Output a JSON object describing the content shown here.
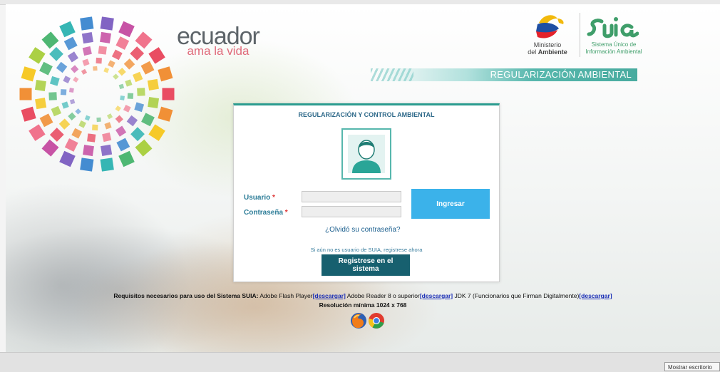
{
  "brand": {
    "title": "ecuador",
    "subtitle": "ama la vida"
  },
  "ministry": {
    "line1": "Ministerio",
    "line2_prefix": "del ",
    "line2_bold": "Ambiente"
  },
  "suia": {
    "line1": "Sistema Único de",
    "line2": "Información Ambiental"
  },
  "banner": {
    "text": "REGULARIZACIÓN AMBIENTAL"
  },
  "login": {
    "title": "REGULARIZACIÓN Y CONTROL AMBIENTAL",
    "user_label": "Usuario",
    "password_label": "Contraseña",
    "required_mark": "*",
    "user_value": "",
    "password_value": "",
    "submit_label": "Ingresar",
    "forgot_label": "¿Olvidó su contraseña?",
    "register_note": "Si aún no es usuario de SUIA, registrese ahora",
    "register_label": "Registrese en el sistema"
  },
  "requirements": {
    "intro": "Requisitos necesarios para uso del Sistema SUIA:",
    "flash": " Adobe Flash Player",
    "reader": " Adobe Reader 8 o superior",
    "jdk": " JDK 7 (Funcionarios que Firman Digitalmente)",
    "download_label": "[descargar]",
    "resolution": "Resolución mínima 1024 x 768"
  },
  "browsers": [
    "firefox-icon",
    "chrome-icon"
  ],
  "taskbar": {
    "show_desktop": "Mostrar escritorio"
  },
  "colors": {
    "accent": "#2b9c8f",
    "primary_button": "#3bb2ea",
    "register_button": "#17606f",
    "label": "#2d7d98"
  }
}
